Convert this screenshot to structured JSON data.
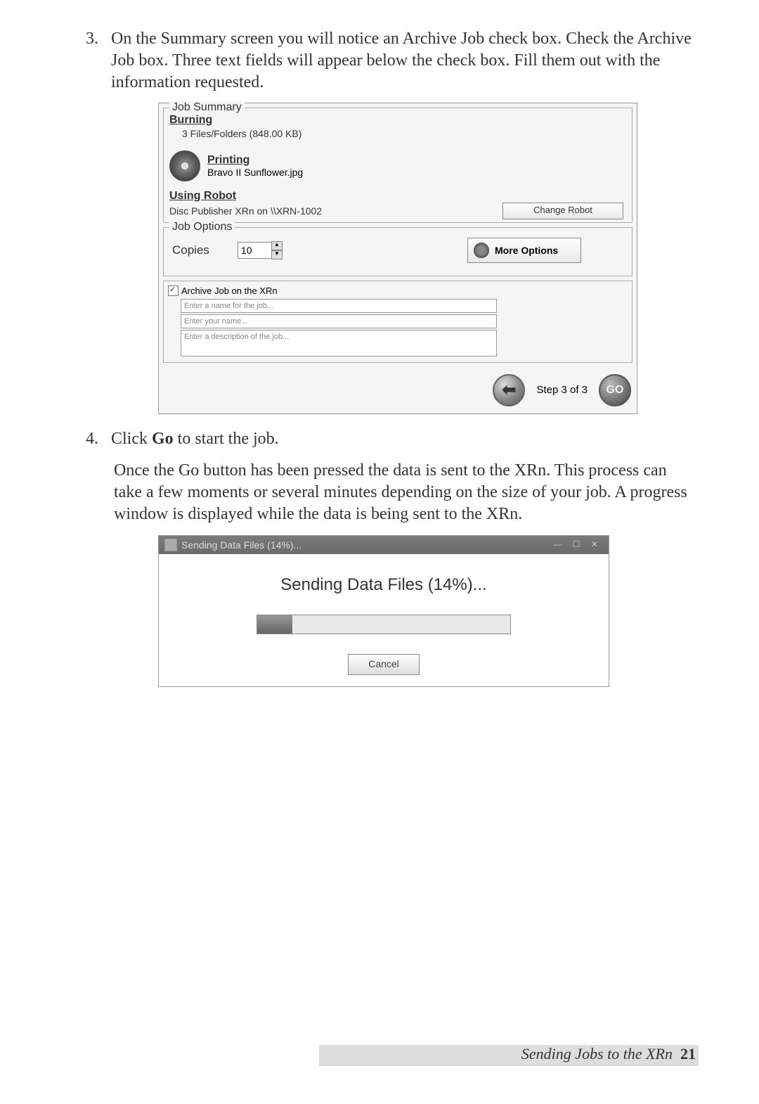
{
  "instr3": {
    "num": "3.",
    "text": "On the Summary screen you will notice an Archive Job check box. Check the Archive Job box.  Three text fields will appear below the check box.  Fill them out with the information requested."
  },
  "summary": {
    "legend": "Job Summary",
    "burning": {
      "heading": "Burning",
      "detail": "3 Files/Folders (848.00 KB)"
    },
    "printing": {
      "heading": "Printing",
      "detail": "Bravo II Sunflower.jpg"
    },
    "robot": {
      "heading": "Using Robot",
      "detail": "Disc Publisher XRn  on \\\\XRN-1002",
      "button": "Change Robot"
    }
  },
  "options": {
    "legend": "Job Options",
    "copies_label": "Copies",
    "copies_value": "10",
    "more_options": "More Options"
  },
  "archive": {
    "checkbox_label": "Archive Job on the XRn",
    "placeholder1": "Enter a name for the job...",
    "placeholder2": "Enter your name...",
    "placeholder3": "Enter a description of the job..."
  },
  "nav": {
    "step_text": "Step 3 of 3",
    "go": "GO"
  },
  "instr4": {
    "num": "4.",
    "text_pre": "Click ",
    "text_bold": "Go",
    "text_post": " to start the job."
  },
  "para": "Once the Go button has been pressed the data is sent to the XRn.  This process can take a few moments or several minutes depending on the size of your job.  A progress window is displayed while the data is being sent to the XRn.",
  "progress": {
    "title": "Sending Data Files (14%)...",
    "heading": "Sending Data Files (14%)...",
    "cancel": "Cancel"
  },
  "footer": {
    "title": "Sending Jobs to the XRn",
    "page": "21"
  }
}
